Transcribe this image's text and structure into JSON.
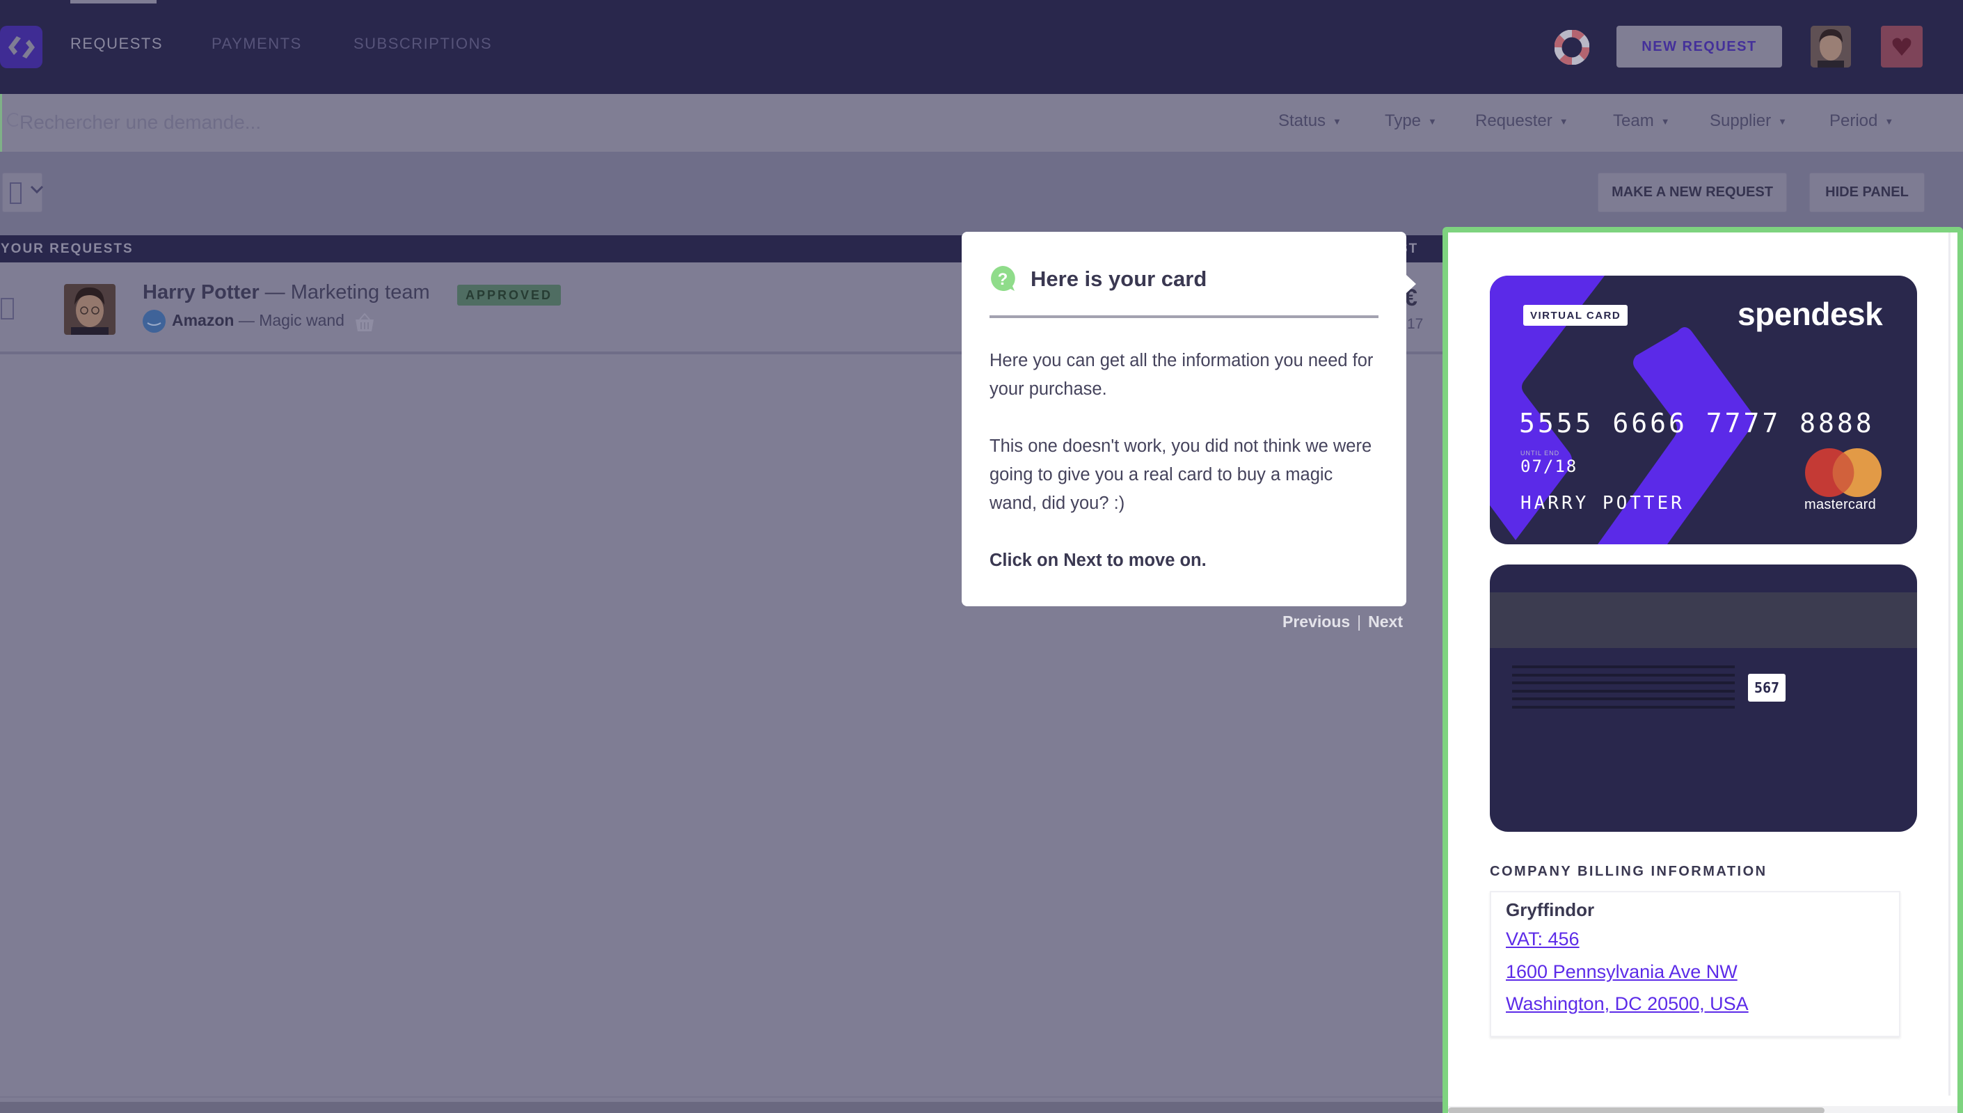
{
  "header": {
    "logo": "spendesk-logo-icon",
    "tabs": [
      {
        "label": "REQUESTS",
        "active": true
      },
      {
        "label": "PAYMENTS",
        "active": false
      },
      {
        "label": "SUBSCRIPTIONS",
        "active": false
      }
    ],
    "help_icon": "lifebuoy-icon",
    "new_request_label": "NEW REQUEST",
    "user_avatar": "harry-potter-avatar",
    "favorite_icon": "heart-icon"
  },
  "search": {
    "placeholder": "Rechercher une demande...",
    "value": "",
    "filters": [
      "Status",
      "Type",
      "Requester",
      "Team",
      "Supplier",
      "Period"
    ]
  },
  "toolbar": {
    "make_new_request_label": "MAKE A NEW REQUEST",
    "hide_panel_label": "HIDE PANEL"
  },
  "list": {
    "section_label": "YOUR REQUESTS",
    "right_column_fragment": "ST",
    "rows": [
      {
        "requester": "Harry Potter",
        "separator": " — ",
        "team": "Marketing team",
        "status": "APPROVED",
        "supplier": "Amazon",
        "description": "Magic wand",
        "amount_fragment": "€",
        "date_fragment": "17"
      }
    ]
  },
  "popover": {
    "title": "Here is your card",
    "paragraph_1": "Here you can get all the information you need for your purchase.",
    "paragraph_2": "This one doesn't work, you did not think we were going to give you a real card to buy a magic wand, did you? :)",
    "cta": "Click on Next to move on.",
    "previous_label": "Previous",
    "separator": "|",
    "next_label": "Next"
  },
  "card": {
    "badge": "VIRTUAL CARD",
    "brand": "spendesk",
    "number": "5555 6666 7777 8888",
    "expiry_label": "UNTIL END",
    "expiry": "07/18",
    "holder": "HARRY POTTER",
    "network": "mastercard",
    "cvv": "567"
  },
  "billing": {
    "title": "COMPANY BILLING INFORMATION",
    "company": "Gryffindor",
    "vat": "VAT: 456",
    "address_line_1": "1600 Pennsylvania Ave NW",
    "address_line_2": "Washington, DC 20500, USA"
  },
  "colors": {
    "header_bg": "#29274c",
    "brand_purple": "#5c2be8",
    "highlight_green": "#7ed37f",
    "status_approved": "#4f6d62",
    "link": "#5c2be8"
  }
}
